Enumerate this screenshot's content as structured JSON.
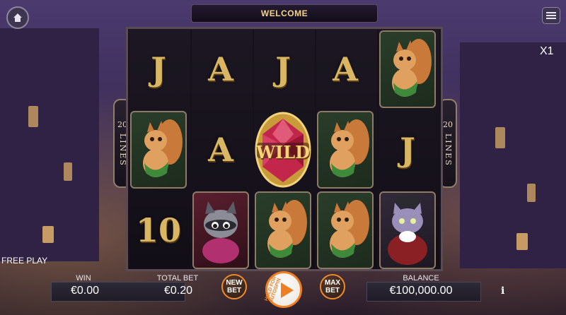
{
  "header": {
    "welcome": "WELCOME"
  },
  "multiplier": "X1",
  "lines_badge": {
    "number": "20",
    "word": "LINES"
  },
  "reels": {
    "row1": [
      "J",
      "A",
      "J",
      "A",
      "squirrel"
    ],
    "row2": [
      "squirrel",
      "A",
      "WILD",
      "squirrel",
      "J"
    ],
    "row3": [
      "10",
      "raccoon",
      "squirrel",
      "squirrel",
      "cat"
    ]
  },
  "wild_label": "WILD",
  "free_play": "FREE PLAY",
  "stats": {
    "win_label": "WIN",
    "win_value": "€0.00",
    "total_bet_label": "TOTAL BET",
    "total_bet_value": "€0.20",
    "balance_label": "BALANCE",
    "balance_value": "€100,000.00"
  },
  "buttons": {
    "new_bet": "NEW BET",
    "max_bet": "MAX BET",
    "hold_for_autospin": "HOLD FOR AUTOSPIN",
    "info": "i"
  },
  "icons": {
    "home": "home-icon",
    "menu": "hamburger-menu-icon",
    "spin": "play-icon"
  },
  "colors": {
    "accent": "#f07e22",
    "gold": "#d9b664",
    "welcome_text": "#f4d38a"
  }
}
